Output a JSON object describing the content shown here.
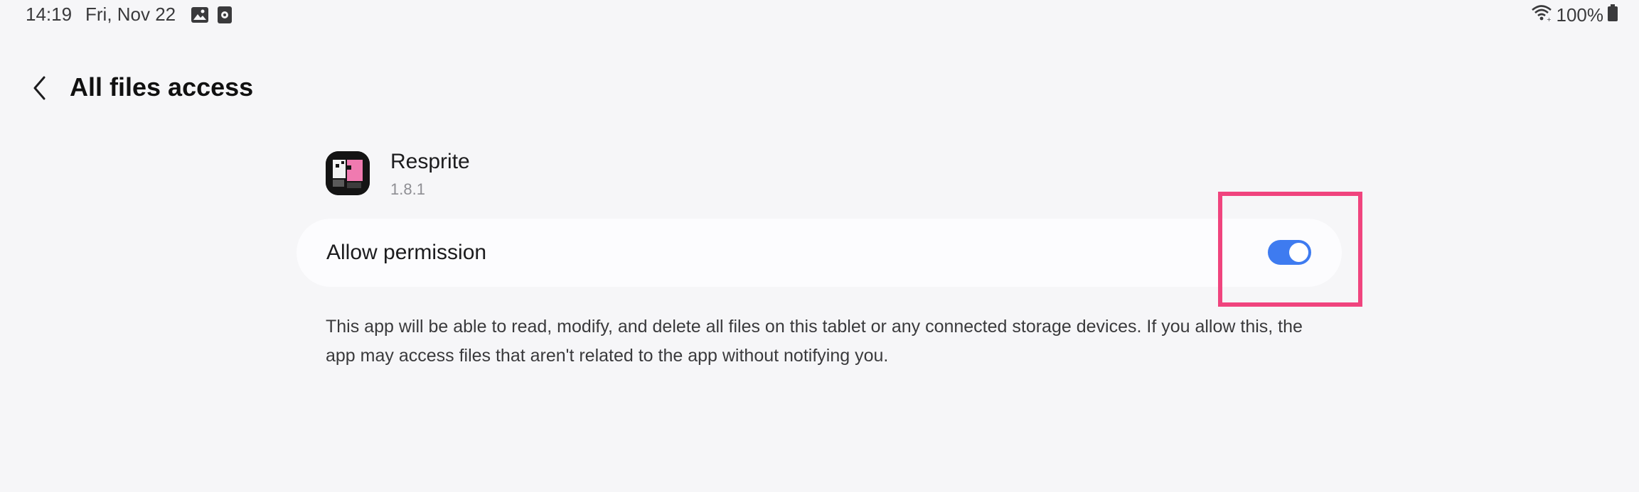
{
  "status_bar": {
    "time": "14:19",
    "date": "Fri, Nov 22",
    "notification_icons": [
      "image-icon",
      "media-icon"
    ],
    "battery_text": "100%",
    "wifi_icon": "wifi-icon",
    "battery_icon": "battery-icon"
  },
  "header": {
    "back_icon": "chevron-left-icon",
    "title": "All files access"
  },
  "app": {
    "name": "Resprite",
    "version": "1.8.1",
    "icon": "resprite-app-icon"
  },
  "permission": {
    "label": "Allow permission",
    "enabled": true,
    "toggle_color": "#3e7bf0"
  },
  "description": "This app will be able to read, modify, and delete all files on this tablet or any connected storage devices. If you allow this, the app may access files that aren't related to the app without notifying you.",
  "highlight_color": "#f0447e"
}
